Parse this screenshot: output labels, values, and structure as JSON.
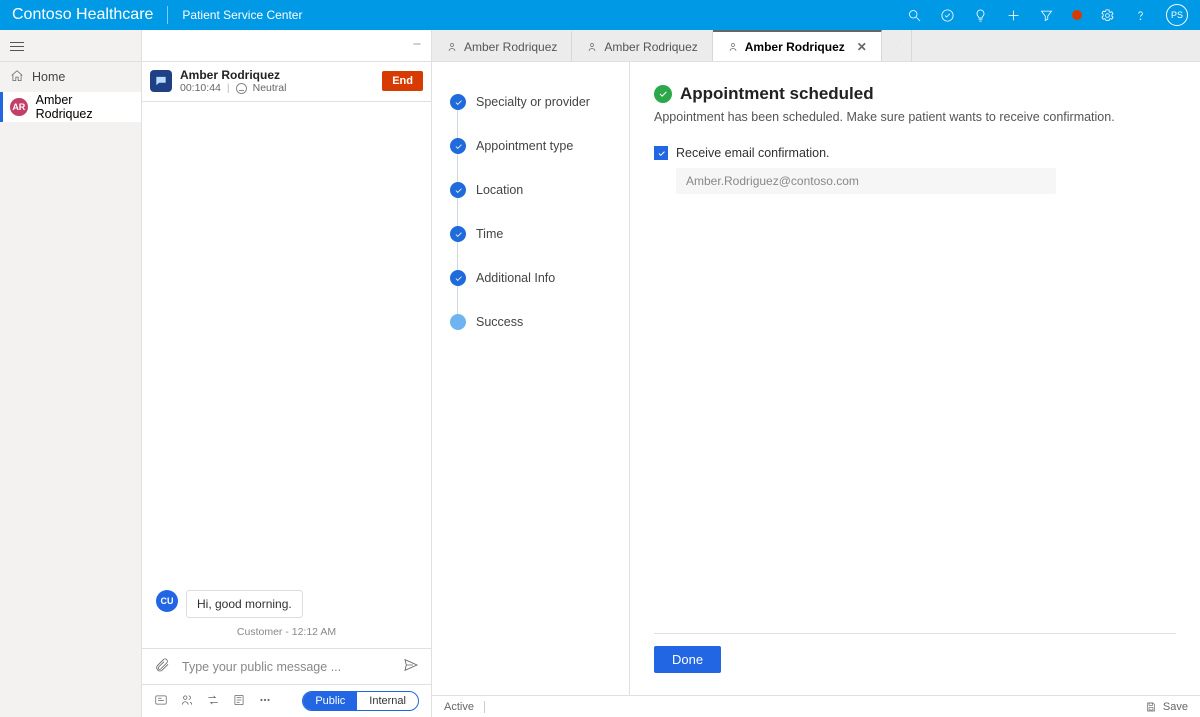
{
  "header": {
    "brand": "Contoso Healthcare",
    "app": "Patient Service Center",
    "avatar_initials": "PS"
  },
  "nav": {
    "home": "Home",
    "active_label": "Amber Rodriquez",
    "active_initials": "AR"
  },
  "conversation": {
    "name": "Amber Rodriquez",
    "timer": "00:10:44",
    "sentiment": "Neutral",
    "end_label": "End"
  },
  "messages": {
    "customer_initials": "CU",
    "text": "Hi, good morning.",
    "meta": "Customer - 12:12 AM"
  },
  "composer": {
    "placeholder": "Type your public message ...",
    "public": "Public",
    "internal": "Internal"
  },
  "tabs": [
    {
      "label": "Amber Rodriquez",
      "active": false
    },
    {
      "label": "Amber Rodriquez",
      "active": false
    },
    {
      "label": "Amber Rodriquez",
      "active": true
    }
  ],
  "steps": [
    {
      "label": "Specialty or provider",
      "state": "done"
    },
    {
      "label": "Appointment type",
      "state": "done"
    },
    {
      "label": "Location",
      "state": "done"
    },
    {
      "label": "Time",
      "state": "done"
    },
    {
      "label": "Additional Info",
      "state": "done"
    },
    {
      "label": "Success",
      "state": "current"
    }
  ],
  "result": {
    "title": "Appointment scheduled",
    "subtitle": "Appointment has been scheduled. Make sure patient wants to receive confirmation.",
    "checkbox_label": "Receive email confirmation.",
    "email": "Amber.Rodriguez@contoso.com",
    "done": "Done"
  },
  "status": {
    "active": "Active",
    "save": "Save"
  }
}
